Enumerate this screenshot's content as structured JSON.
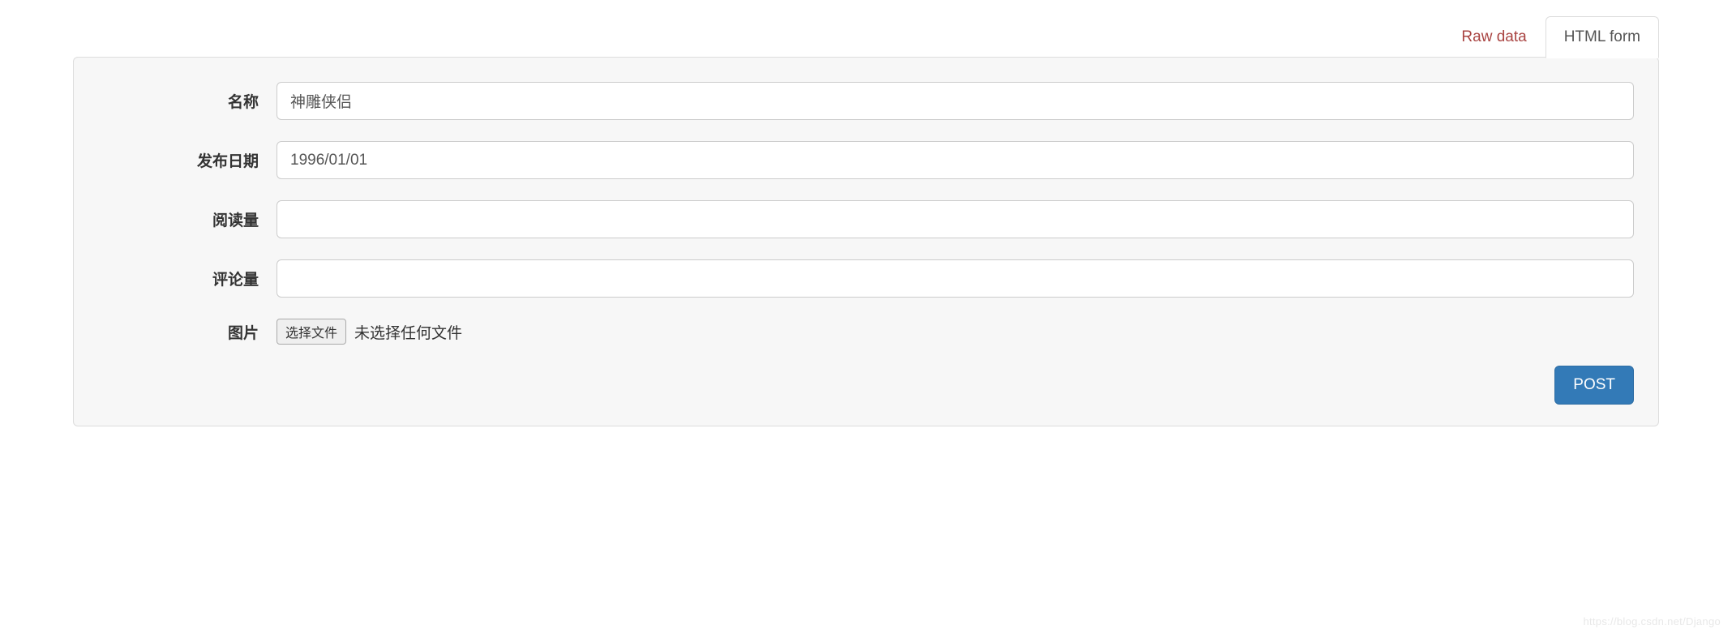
{
  "tabs": {
    "raw_data": "Raw data",
    "html_form": "HTML form"
  },
  "form": {
    "fields": {
      "name": {
        "label": "名称",
        "value": "神雕侠侣"
      },
      "publish_date": {
        "label": "发布日期",
        "value": "1996/01/01"
      },
      "read_count": {
        "label": "阅读量",
        "value": ""
      },
      "comment_count": {
        "label": "评论量",
        "value": ""
      },
      "image": {
        "label": "图片",
        "button": "选择文件",
        "status": "未选择任何文件"
      }
    },
    "submit_label": "POST"
  },
  "watermark": "https://blog.csdn.net/Django"
}
